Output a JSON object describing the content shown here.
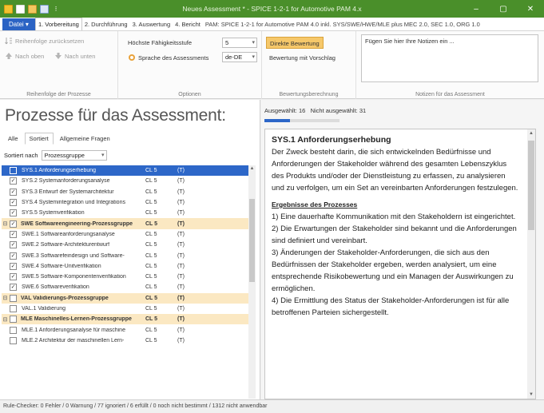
{
  "titlebar": {
    "title": "Neues Assessment * - SPICE 1-2-1 for Automotive PAM 4.x",
    "minimize": "–",
    "maximize": "▢",
    "close": "✕"
  },
  "ribbon_tabs": {
    "file": "Datei",
    "file_arrow": "▾",
    "tabs": [
      "1. Vorbereitung",
      "2. Durchführung",
      "3. Auswertung",
      "4. Bericht"
    ],
    "info": "PAM: SPICE 1-2-1 for Automotive PAM 4.0 inkl. SYS/SWE/HWE/MLE plus MEC 2.0, SEC 1.0, ORG 1.0"
  },
  "ribbon": {
    "reihenfolge": {
      "label": "Reihenfolge der Prozesse",
      "reset": "Reihenfolge zurücksetzen",
      "up": "Nach oben",
      "down": "Nach unten"
    },
    "optionen": {
      "label": "Optionen",
      "level_label": "Höchste Fähigkeitsstufe",
      "level_value": "5",
      "lang_label": "Sprache des Assessments",
      "lang_value": "de-DE"
    },
    "bewertung": {
      "label": "Bewertungsberechnung",
      "direct": "Direkte Bewertung",
      "suggested": "Bewertung mit Vorschlag"
    },
    "notizen": {
      "label": "Notizen für das Assessment",
      "placeholder": "Fügen Sie hier Ihre Notizen ein ..."
    }
  },
  "left": {
    "title": "Prozesse für das Assessment:",
    "view_tabs": [
      "Alle",
      "Sortiert",
      "Allgemeine Fragen"
    ],
    "sort_label": "Sortiert nach",
    "sort_value": "Prozessgruppe",
    "rows": [
      {
        "type": "child",
        "checked": false,
        "name": "SYS.1 Anforderungserhebung",
        "cl": "CL 5",
        "t": "(T)"
      },
      {
        "type": "child",
        "checked": true,
        "name": "SYS.2 Systemanforderungsanalyse",
        "cl": "CL 5",
        "t": "(T)"
      },
      {
        "type": "child",
        "checked": true,
        "name": "SYS.3 Entwurf der Systemarchitektur",
        "cl": "CL 5",
        "t": "(T)"
      },
      {
        "type": "child",
        "checked": true,
        "name": "SYS.4 Systemintegration und Integrations",
        "cl": "CL 5",
        "t": "(T)"
      },
      {
        "type": "child",
        "checked": true,
        "name": "SYS.5 Systemverifikation",
        "cl": "CL 5",
        "t": "(T)"
      },
      {
        "type": "group",
        "checked": true,
        "name": "SWE Softwareengineering-Prozessgruppe",
        "cl": "CL 5",
        "t": "(T)"
      },
      {
        "type": "child",
        "checked": true,
        "name": "SWE.1 Softwareanforderungsanalyse",
        "cl": "CL 5",
        "t": "(T)"
      },
      {
        "type": "child",
        "checked": true,
        "name": "SWE.2 Software-Architekturentwurf",
        "cl": "CL 5",
        "t": "(T)"
      },
      {
        "type": "child",
        "checked": true,
        "name": "SWE.3 Softwarefeindesign und Software-",
        "cl": "CL 5",
        "t": "(T)"
      },
      {
        "type": "child",
        "checked": true,
        "name": "SWE.4 Software-Unitverifikation",
        "cl": "CL 5",
        "t": "(T)"
      },
      {
        "type": "child",
        "checked": true,
        "name": "SWE.5 Software-Komponentenverifikation",
        "cl": "CL 5",
        "t": "(T)"
      },
      {
        "type": "child",
        "checked": true,
        "name": "SWE.6 Softwareverifikation",
        "cl": "CL 5",
        "t": "(T)"
      },
      {
        "type": "group",
        "checked": false,
        "name": "VAL Validierungs-Prozessgruppe",
        "cl": "CL 5",
        "t": "(T)"
      },
      {
        "type": "child",
        "checked": false,
        "name": "VAL.1 Validierung",
        "cl": "CL 5",
        "t": "(T)"
      },
      {
        "type": "group",
        "checked": false,
        "name": "MLE Maschinelles-Lernen-Prozessgruppe",
        "cl": "CL 5",
        "t": "(T)"
      },
      {
        "type": "child",
        "checked": false,
        "name": "MLE.1 Anforderungsanalyse für maschine",
        "cl": "CL 5",
        "t": "(T)"
      },
      {
        "type": "child",
        "checked": false,
        "name": "MLE.2 Architektur der maschinellen Lern-",
        "cl": "CL 5",
        "t": "(T)"
      }
    ]
  },
  "right": {
    "selected_label": "Ausgewählt: 16",
    "not_selected_label": "Nicht ausgewählt: 31",
    "selected_fraction": 0.34,
    "title": "SYS.1  Anforderungserhebung",
    "purpose": "Der Zweck besteht darin, die sich entwickelnden Bedürfnisse und Anforderungen der Stakeholder während des gesamten Lebenszyklus des Produkts und/oder der Dienstleistung zu erfassen, zu analysieren und zu verfolgen, um ein Set an vereinbarten Anforderungen festzulegen.",
    "outcomes_title": "Ergebnisse des Prozesses",
    "outcomes": [
      "1) Eine dauerhafte Kommunikation mit den Stakeholdern ist eingerichtet.",
      "2) Die Erwartungen der Stakeholder sind bekannt und die Anforderungen sind definiert und vereinbart.",
      "3) Änderungen der Stakeholder-Anforderungen, die sich aus den Bedürfnissen der Stakeholder ergeben, werden analysiert, um eine entsprechende Risikobewertung und ein Managen der Auswirkungen zu ermöglichen.",
      "4) Die Ermittlung des Status der Stakeholder-Anforderungen ist für alle betroffenen Parteien sichergestellt."
    ]
  },
  "statusbar": {
    "text": "Rule-Checker: 0 Fehler / 0 Warnung / 77 ignoriert / 6 erfüllt / 0 noch nicht bestimmt / 1312 nicht anwendbar"
  },
  "colors": {
    "titlebar": "#4a8f2a",
    "accent_blue": "#2d67c8",
    "group_row": "#fbe8c2",
    "active_button": "#f6c86a"
  }
}
